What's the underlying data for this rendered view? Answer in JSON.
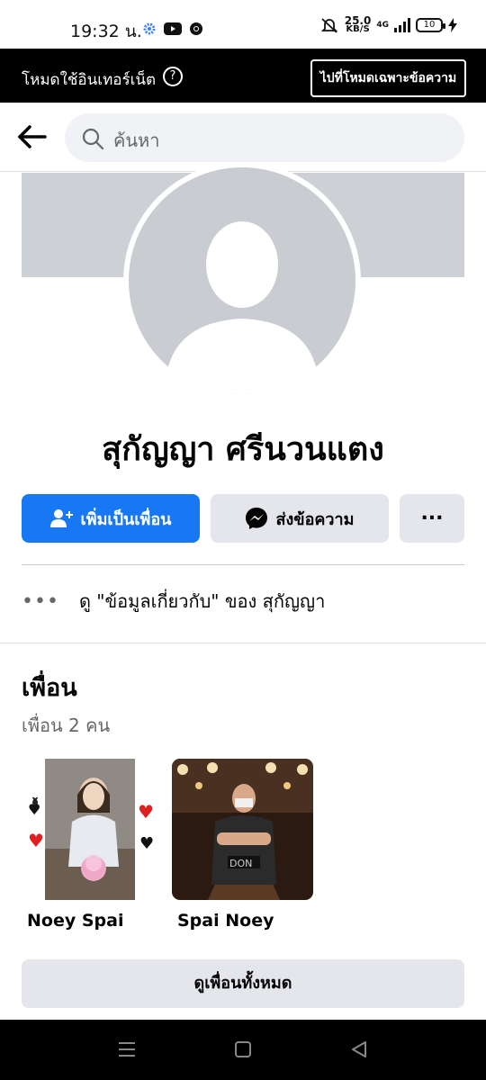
{
  "status_bar": {
    "time": "19:32 น.",
    "net_speed_value": "25.0",
    "net_speed_unit": "KB/S",
    "network": "4G",
    "battery": "10"
  },
  "banner": {
    "text": "โหมดใช้อินเทอร์เน็ต",
    "help": "?",
    "button": "ไปที่โหมดเฉพาะข้อความ"
  },
  "search": {
    "placeholder": "ค้นหา"
  },
  "profile": {
    "name": "สุกัญญา ศรีนวนแตง",
    "add_friend": "เพิ่มเป็นเพื่อน",
    "message": "ส่งข้อความ",
    "more": "...",
    "about_link": "ดู \"ข้อมูลเกี่ยวกับ\" ของ สุกัญญา"
  },
  "friends": {
    "title": "เพื่อน",
    "count": "เพื่อน 2 คน",
    "items": [
      {
        "name": "Noey Spai"
      },
      {
        "name": "Spai Noey"
      }
    ],
    "see_all": "ดูเพื่อนทั้งหมด"
  },
  "colors": {
    "primary": "#1877f2",
    "button_gray": "#e4e6eb",
    "banner": "#000000"
  }
}
